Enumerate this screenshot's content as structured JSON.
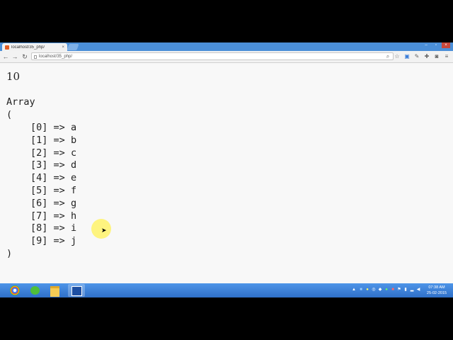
{
  "browser": {
    "tab_title": "localhost/35_php/",
    "tab_close": "×",
    "url": "localhost/35_php/",
    "back": "←",
    "forward": "→",
    "reload": "↻",
    "window_minimize": "–",
    "window_maximize": "▫",
    "window_close": "×"
  },
  "page": {
    "result": "10",
    "array_keyword": "Array",
    "open_paren": "(",
    "close_paren": ")",
    "entries": [
      {
        "key": "[0]",
        "arrow": "=>",
        "value": "a"
      },
      {
        "key": "[1]",
        "arrow": "=>",
        "value": "b"
      },
      {
        "key": "[2]",
        "arrow": "=>",
        "value": "c"
      },
      {
        "key": "[3]",
        "arrow": "=>",
        "value": "d"
      },
      {
        "key": "[4]",
        "arrow": "=>",
        "value": "e"
      },
      {
        "key": "[5]",
        "arrow": "=>",
        "value": "f"
      },
      {
        "key": "[6]",
        "arrow": "=>",
        "value": "g"
      },
      {
        "key": "[7]",
        "arrow": "=>",
        "value": "h"
      },
      {
        "key": "[8]",
        "arrow": "=>",
        "value": "i"
      },
      {
        "key": "[9]",
        "arrow": "=>",
        "value": "j"
      }
    ]
  },
  "taskbar": {
    "time": "07:38 AM",
    "date": "25-02-2015"
  },
  "icons": {
    "toolbar": [
      "search-icon",
      "star-icon",
      "translate-icon",
      "extension-icon",
      "wrench-icon",
      "camera-icon",
      "menu-icon"
    ],
    "taskbar": [
      "start-orb-icon",
      "chrome-icon",
      "green-app-icon",
      "folder-icon",
      "app-window-icon"
    ]
  },
  "colors": {
    "tabstrip": "#4b8fd8",
    "taskbar": "#2f6fc8",
    "page_bg": "#f8f8f8",
    "cursor_highlight": "#fff36a"
  }
}
